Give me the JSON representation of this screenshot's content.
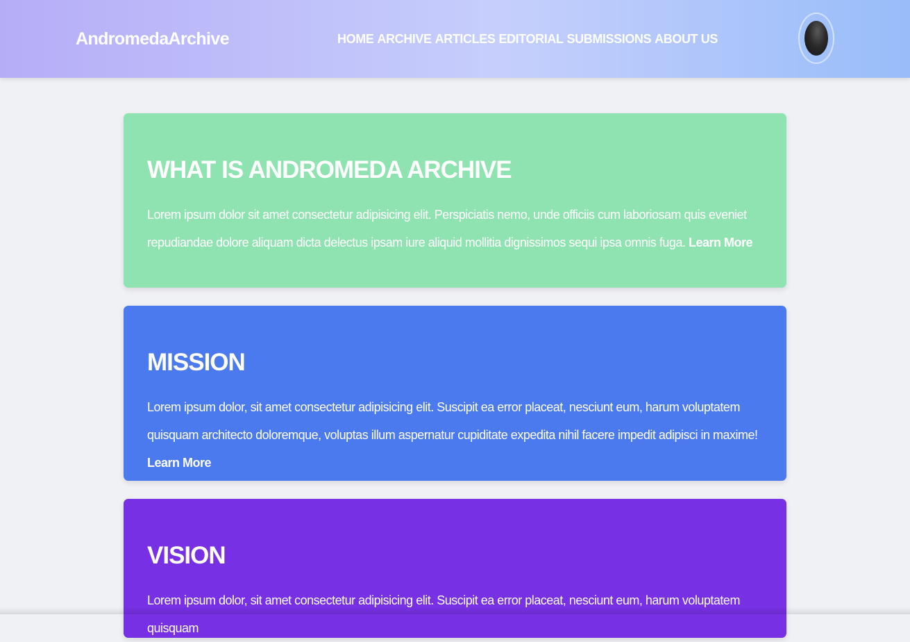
{
  "header": {
    "logo": "AndromedaArchive",
    "nav": [
      "HOME",
      "ARCHIVE",
      "ARTICLES",
      "EDITORIAL",
      "SUBMISSIONS",
      "ABOUT US"
    ]
  },
  "sections": [
    {
      "title": "WHAT IS ANDROMEDA ARCHIVE",
      "text": "Lorem ipsum dolor sit amet consectetur adipisicing elit. Perspiciatis nemo, unde officiis cum laboriosam quis eveniet repudiandae dolore aliquam dicta delectus ipsam iure aliquid mollitia dignissimos sequi ipsa omnis fuga.",
      "link": "Learn More"
    },
    {
      "title": "MISSION",
      "text": "Lorem ipsum dolor, sit amet consectetur adipisicing elit. Suscipit ea error placeat, nesciunt eum, harum voluptatem quisquam architecto doloremque, voluptas illum aspernatur cupiditate expedita nihil facere impedit adipisci in maxime!",
      "link": "Learn More"
    },
    {
      "title": "VISION",
      "text": "Lorem ipsum dolor, sit amet consectetur adipisicing elit. Suscipit ea error placeat, nesciunt eum, harum voluptatem quisquam",
      "link": ""
    }
  ],
  "colors": {
    "card_what": "#8fe3b0",
    "card_mission": "#4b79ee",
    "card_vision": "#7730e3",
    "page_background": "#f0f1f5"
  }
}
